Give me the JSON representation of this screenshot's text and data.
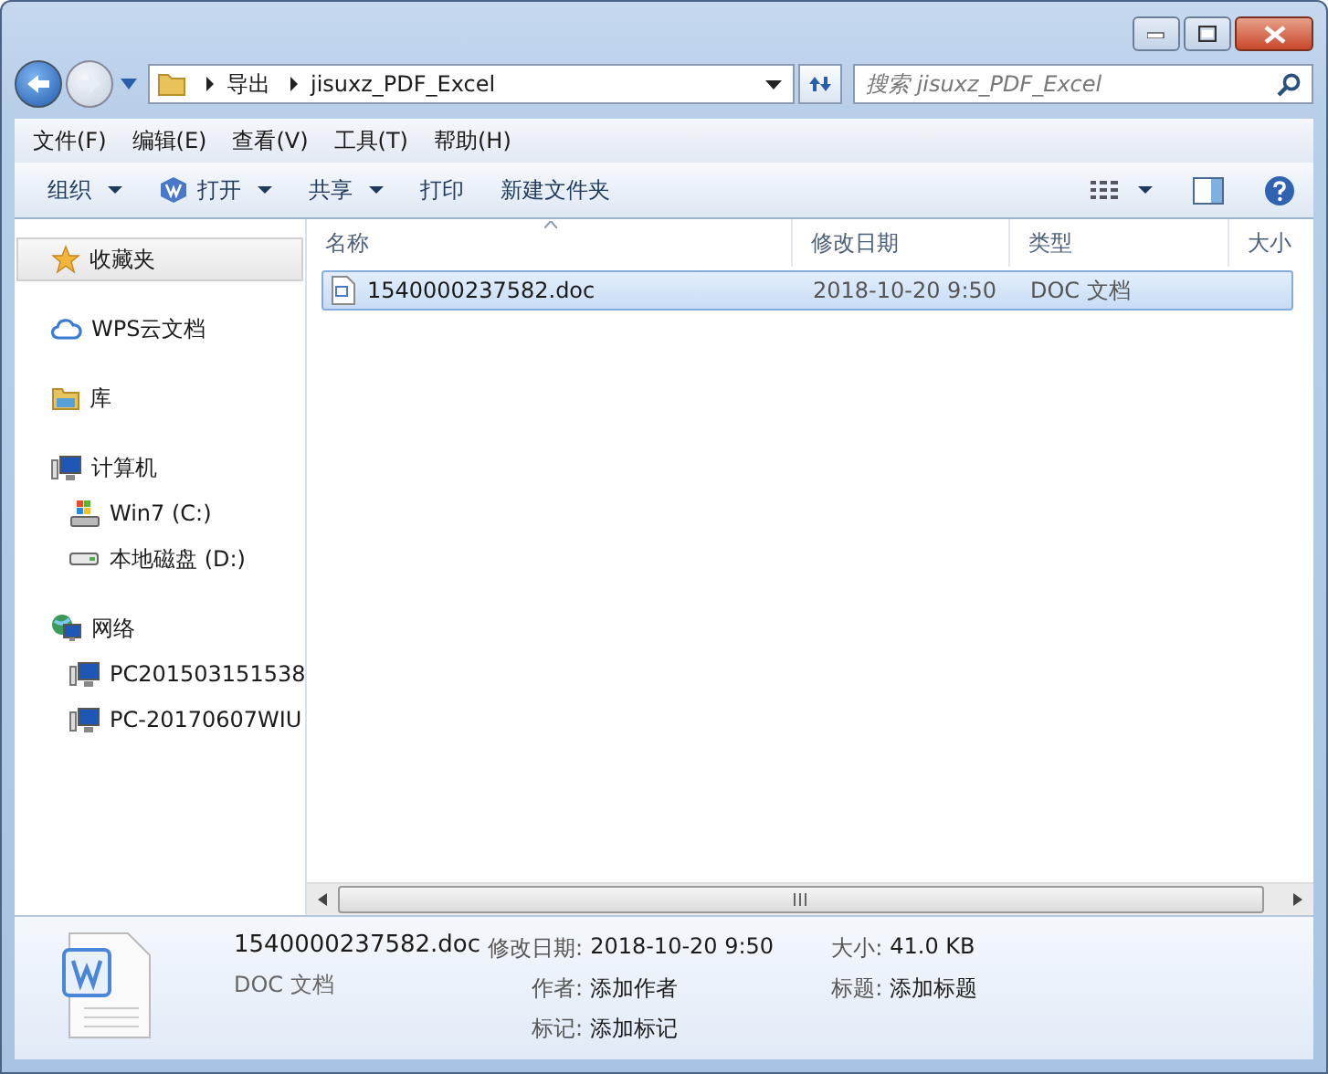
{
  "address": {
    "path": [
      "导出",
      "jisuxz_PDF_Excel"
    ]
  },
  "search": {
    "placeholder": "搜索 jisuxz_PDF_Excel"
  },
  "menu": [
    "文件(F)",
    "编辑(E)",
    "查看(V)",
    "工具(T)",
    "帮助(H)"
  ],
  "toolbar": [
    {
      "label": "组织",
      "kind": "dropdown"
    },
    {
      "label": "打开",
      "kind": "app-dropdown"
    },
    {
      "label": "共享",
      "kind": "dropdown"
    },
    {
      "label": "打印",
      "kind": "plain"
    },
    {
      "label": "新建文件夹",
      "kind": "plain"
    }
  ],
  "sidebar": {
    "groups": [
      {
        "label": "收藏夹",
        "kind": "star",
        "selected": true
      },
      {
        "label": "WPS云文档",
        "kind": "cloud",
        "selected": false
      },
      {
        "label": "库",
        "kind": "library",
        "selected": false
      },
      {
        "label": "计算机",
        "kind": "computer",
        "selected": false,
        "children": [
          {
            "label": "Win7 (C:)",
            "kind": "system-drive",
            "selected": false
          },
          {
            "label": "本地磁盘 (D:)",
            "kind": "drive",
            "selected": false
          }
        ]
      },
      {
        "label": "网络",
        "kind": "network",
        "selected": false,
        "children": [
          {
            "label": "PC201503151538",
            "kind": "computer",
            "selected": false
          },
          {
            "label": "PC-20170607WIU",
            "kind": "computer",
            "selected": false
          }
        ]
      }
    ]
  },
  "table": {
    "columns": [
      {
        "label": "名称",
        "sorted": true
      },
      {
        "label": "修改日期",
        "sorted": false
      },
      {
        "label": "类型",
        "sorted": false
      },
      {
        "label": "大小",
        "sorted": false
      }
    ],
    "rows": [
      {
        "name": "1540000237582.doc",
        "date": "2018-10-20 9:50",
        "type": "DOC 文档",
        "selected": true
      }
    ]
  },
  "details": {
    "name": "1540000237582.doc",
    "type": "DOC 文档",
    "fields": [
      {
        "label": "修改日期:",
        "value": "2018-10-20 9:50"
      },
      {
        "label": "大小:",
        "value": "41.0 KB"
      },
      {
        "label": "作者:",
        "value": "添加作者"
      },
      {
        "label": "标题:",
        "value": "添加标题"
      },
      {
        "label": "标记:",
        "value": "添加标记"
      }
    ]
  }
}
